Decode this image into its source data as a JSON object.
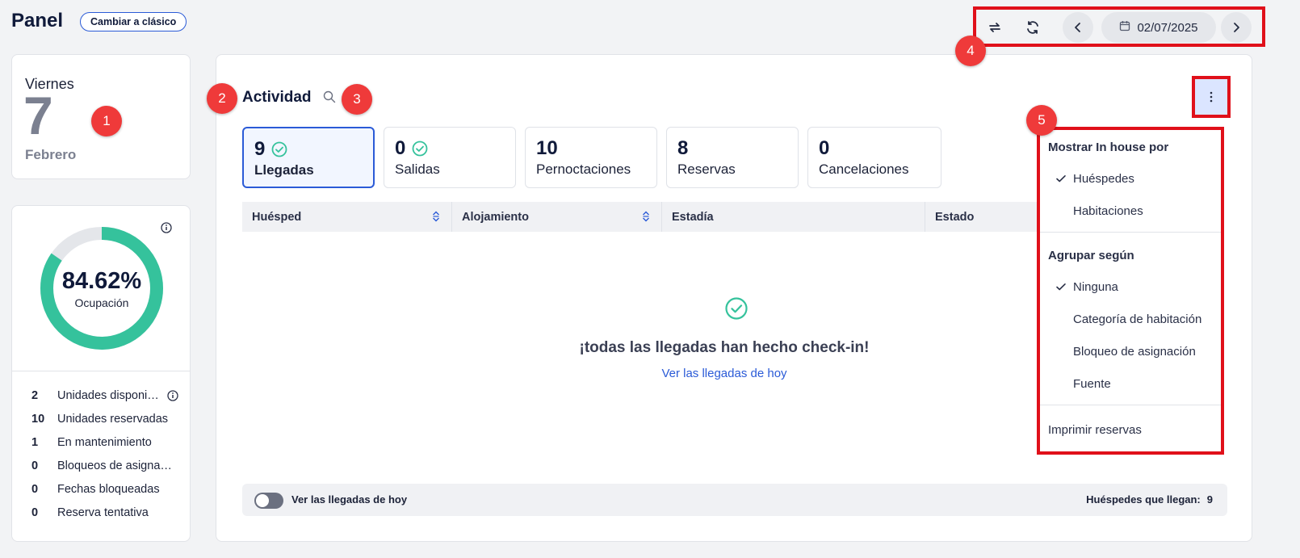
{
  "header": {
    "title": "Panel",
    "classic_button": "Cambiar a clásico"
  },
  "toolbar": {
    "date": "02/07/2025",
    "icons": [
      "swap-icon",
      "refresh-icon",
      "chevron-left-icon",
      "calendar-icon",
      "chevron-right-icon"
    ]
  },
  "annotations": [
    "1",
    "2",
    "3",
    "4",
    "5"
  ],
  "date_card": {
    "weekday": "Viernes",
    "day": "7",
    "month": "Febrero"
  },
  "occupancy": {
    "percent": "84.62%",
    "label": "Ocupación",
    "value": 84.62,
    "colors": {
      "filled": "#35c29c",
      "empty": "#e4e6ea"
    },
    "stats": [
      {
        "num": "2",
        "label": "Unidades disponi…",
        "info": true
      },
      {
        "num": "10",
        "label": "Unidades reservadas"
      },
      {
        "num": "1",
        "label": "En mantenimiento"
      },
      {
        "num": "0",
        "label": "Bloqueos de asigna…"
      },
      {
        "num": "0",
        "label": "Fechas bloqueadas"
      },
      {
        "num": "0",
        "label": "Reserva tentativa"
      }
    ]
  },
  "activity": {
    "title": "Actividad",
    "kpis": [
      {
        "num": "9",
        "label": "Llegadas",
        "check": true,
        "active": true
      },
      {
        "num": "0",
        "label": "Salidas",
        "check": true
      },
      {
        "num": "10",
        "label": "Pernoctaciones"
      },
      {
        "num": "8",
        "label": "Reservas"
      },
      {
        "num": "0",
        "label": "Cancelaciones"
      }
    ],
    "columns": [
      "Huésped",
      "Alojamiento",
      "Estadía",
      "Estado"
    ],
    "empty_title": "¡todas las llegadas han hecho check-in!",
    "empty_link": "Ver las llegadas de hoy",
    "footer": {
      "toggle_label": "Ver las llegadas de hoy",
      "guests_label": "Huéspedes que llegan:",
      "guests_count": "9"
    }
  },
  "menu": {
    "section1": "Mostrar In house por",
    "guests": "Huéspedes",
    "rooms": "Habitaciones",
    "section2": "Agrupar según",
    "none": "Ninguna",
    "room_category": "Categoría de habitación",
    "assignment_block": "Bloqueo de asignación",
    "source": "Fuente",
    "print": "Imprimir reservas"
  },
  "colors": {
    "accent": "#2b5bd7",
    "success": "#35c29c",
    "highlight_red": "#e0101a",
    "badge_red": "#ef3a3a"
  }
}
